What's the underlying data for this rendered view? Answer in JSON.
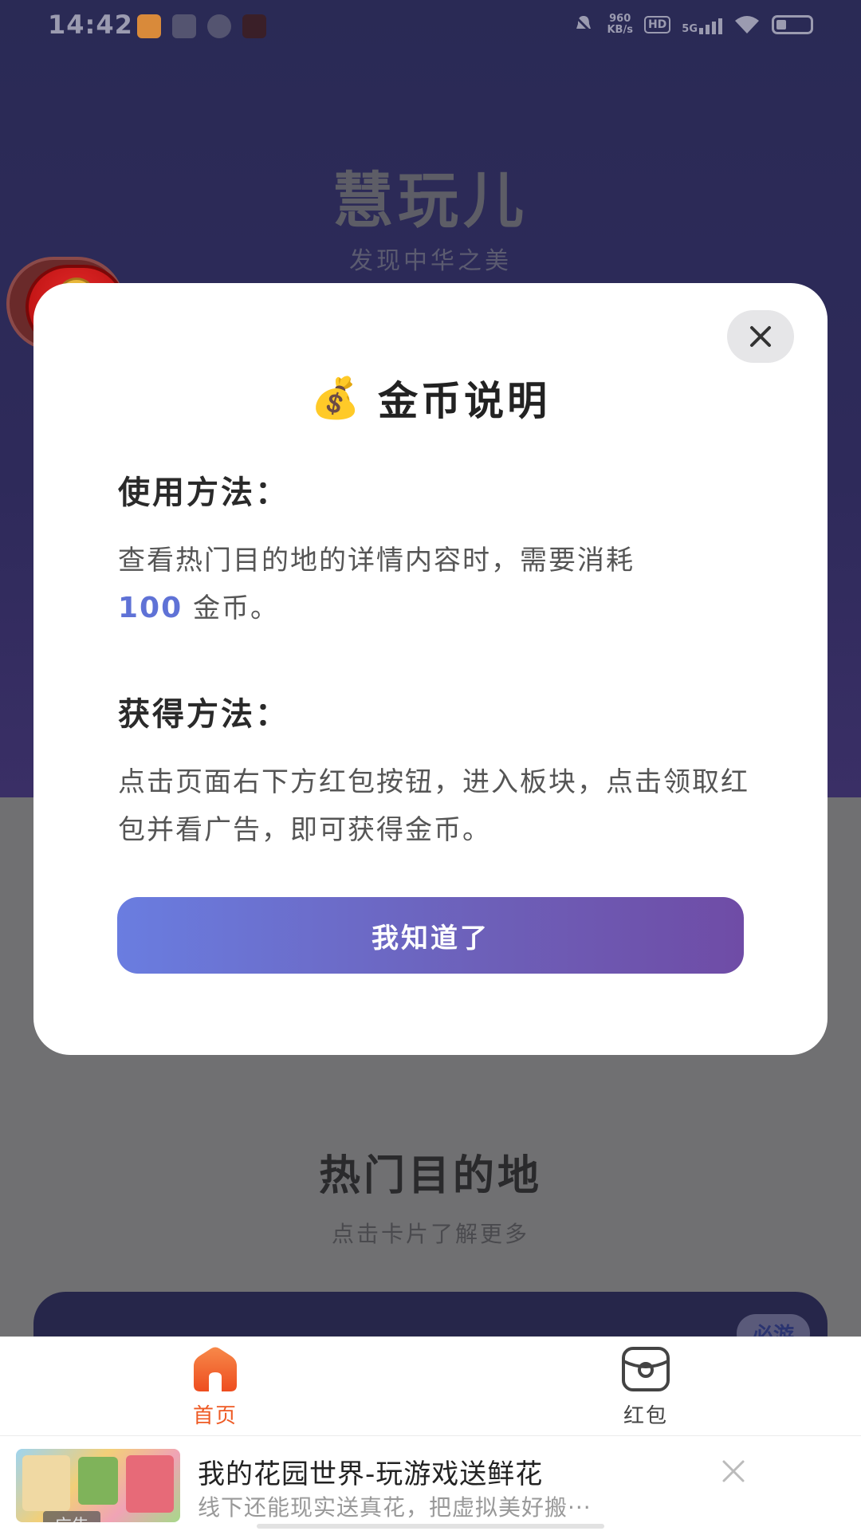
{
  "status_bar": {
    "time": "14:42",
    "net_speed_value": "960",
    "net_speed_unit": "KB/s",
    "hd": "HD",
    "network": "5G"
  },
  "app": {
    "title": "慧玩儿",
    "subtitle": "发现中华之美"
  },
  "modal": {
    "icon": "money-bag-icon",
    "title": "金币说明",
    "usage_heading": "使用方法：",
    "usage_text_before": "查看热门目的地的详情内容时，需要消耗",
    "usage_amount": "100",
    "usage_text_after": " 金币。",
    "earn_heading": "获得方法：",
    "earn_text": "点击页面右下方红包按钮，进入板块，点击领取红包并看广告，即可获得金币。",
    "confirm_label": "我知道了"
  },
  "background_section": {
    "title": "热门目的地",
    "subtitle": "点击卡片了解更多",
    "card_badge": "必游"
  },
  "bottom_nav": {
    "items": [
      {
        "label": "首页",
        "icon": "home-icon",
        "active": true
      },
      {
        "label": "红包",
        "icon": "redpacket-icon",
        "active": false
      }
    ]
  },
  "ad": {
    "tag": "广告",
    "title": "我的花园世界-玩游戏送鲜花",
    "description": "线下还能现实送真花，把虚拟美好搬···"
  },
  "colors": {
    "accent": "#5f72d6",
    "button_start": "#6a7de0",
    "button_end": "#6f4ca6",
    "nav_active": "#ee5a24"
  }
}
